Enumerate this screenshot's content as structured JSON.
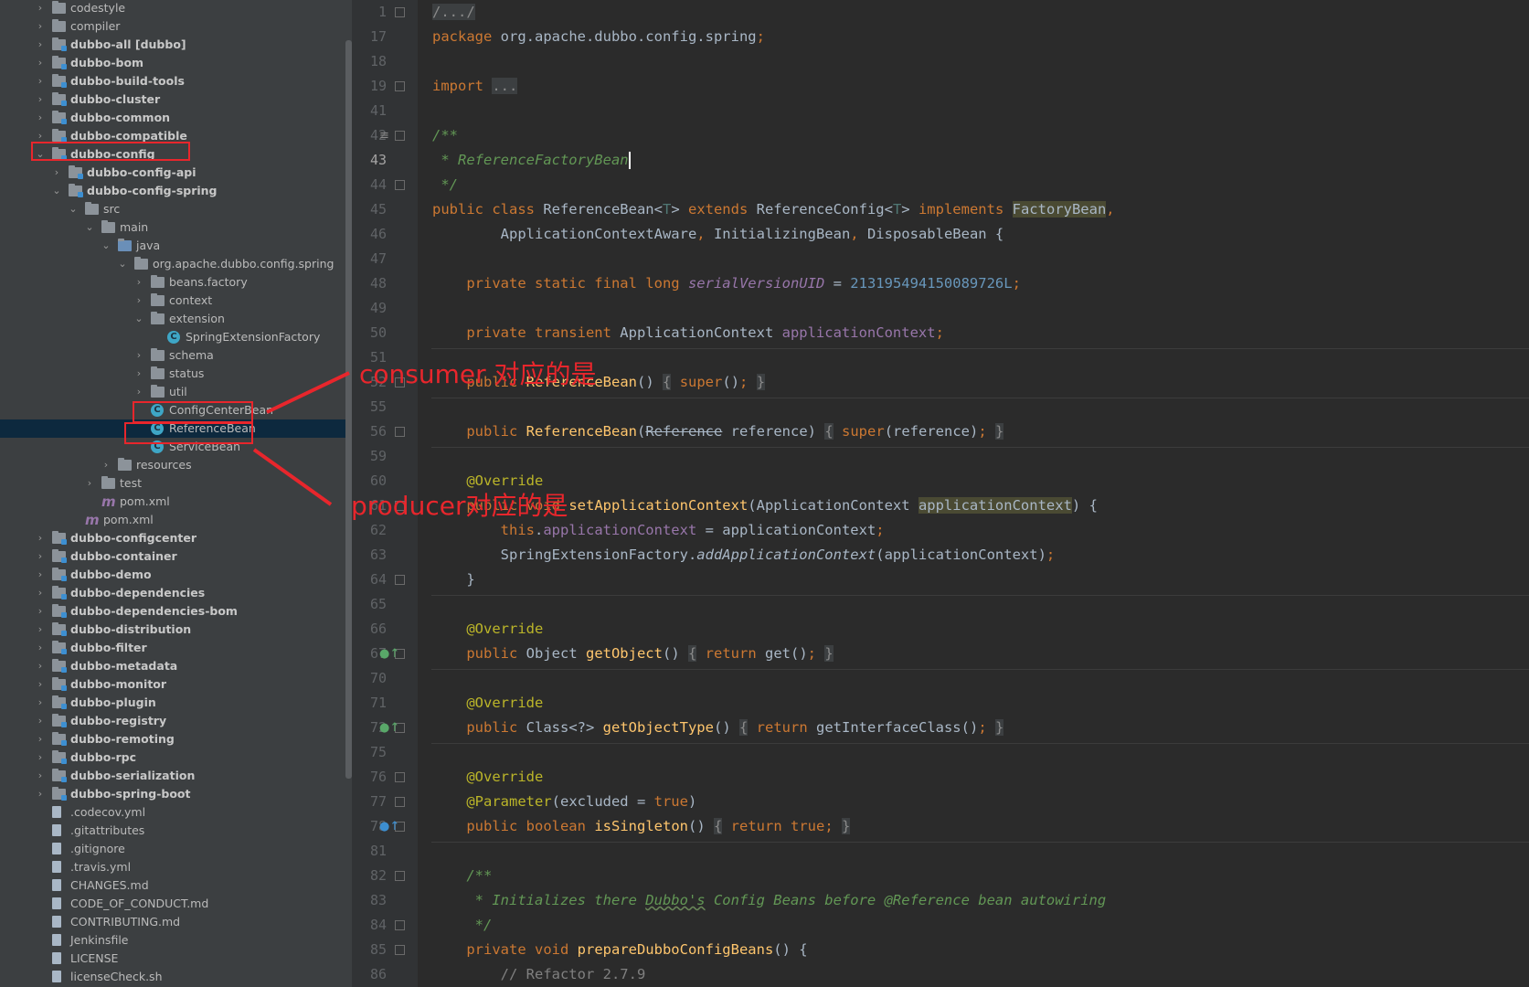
{
  "tree": {
    "items": [
      {
        "label": "codestyle",
        "indent": 0,
        "arrow": "›",
        "icon": "folder-icon",
        "bold": false
      },
      {
        "label": "compiler",
        "indent": 0,
        "arrow": "›",
        "icon": "folder-icon",
        "bold": false
      },
      {
        "label": "dubbo-all [dubbo]",
        "indent": 0,
        "arrow": "›",
        "icon": "module-icon",
        "bold": true
      },
      {
        "label": "dubbo-bom",
        "indent": 0,
        "arrow": "›",
        "icon": "module-icon",
        "bold": true
      },
      {
        "label": "dubbo-build-tools",
        "indent": 0,
        "arrow": "›",
        "icon": "module-icon",
        "bold": true
      },
      {
        "label": "dubbo-cluster",
        "indent": 0,
        "arrow": "›",
        "icon": "module-icon",
        "bold": true
      },
      {
        "label": "dubbo-common",
        "indent": 0,
        "arrow": "›",
        "icon": "module-icon",
        "bold": true
      },
      {
        "label": "dubbo-compatible",
        "indent": 0,
        "arrow": "›",
        "icon": "module-icon",
        "bold": true
      },
      {
        "label": "dubbo-config",
        "indent": 0,
        "arrow": "⌄",
        "icon": "module-icon",
        "bold": true
      },
      {
        "label": "dubbo-config-api",
        "indent": 1,
        "arrow": "›",
        "icon": "module-icon",
        "bold": true
      },
      {
        "label": "dubbo-config-spring",
        "indent": 1,
        "arrow": "⌄",
        "icon": "module-icon",
        "bold": true
      },
      {
        "label": "src",
        "indent": 2,
        "arrow": "⌄",
        "icon": "folder-icon",
        "bold": false
      },
      {
        "label": "main",
        "indent": 3,
        "arrow": "⌄",
        "icon": "folder-icon",
        "bold": false
      },
      {
        "label": "java",
        "indent": 4,
        "arrow": "⌄",
        "icon": "source-folder-icon",
        "bold": false
      },
      {
        "label": "org.apache.dubbo.config.spring",
        "indent": 5,
        "arrow": "⌄",
        "icon": "package-icon",
        "bold": false
      },
      {
        "label": "beans.factory",
        "indent": 6,
        "arrow": "›",
        "icon": "package-icon",
        "bold": false
      },
      {
        "label": "context",
        "indent": 6,
        "arrow": "›",
        "icon": "package-icon",
        "bold": false
      },
      {
        "label": "extension",
        "indent": 6,
        "arrow": "⌄",
        "icon": "package-icon",
        "bold": false
      },
      {
        "label": "SpringExtensionFactory",
        "indent": 7,
        "arrow": "",
        "icon": "class-icon",
        "bold": false
      },
      {
        "label": "schema",
        "indent": 6,
        "arrow": "›",
        "icon": "package-icon",
        "bold": false
      },
      {
        "label": "status",
        "indent": 6,
        "arrow": "›",
        "icon": "package-icon",
        "bold": false
      },
      {
        "label": "util",
        "indent": 6,
        "arrow": "›",
        "icon": "package-icon",
        "bold": false
      },
      {
        "label": "ConfigCenterBean",
        "indent": 6,
        "arrow": "",
        "icon": "class-icon",
        "bold": false
      },
      {
        "label": "ReferenceBean",
        "indent": 6,
        "arrow": "",
        "icon": "class-icon",
        "bold": false,
        "selected": true
      },
      {
        "label": "ServiceBean",
        "indent": 6,
        "arrow": "",
        "icon": "class-icon",
        "bold": false
      },
      {
        "label": "resources",
        "indent": 4,
        "arrow": "›",
        "icon": "resources-folder-icon",
        "bold": false
      },
      {
        "label": "test",
        "indent": 3,
        "arrow": "›",
        "icon": "folder-icon",
        "bold": false
      },
      {
        "label": "pom.xml",
        "indent": 3,
        "arrow": "",
        "icon": "maven-icon",
        "bold": false
      },
      {
        "label": "pom.xml",
        "indent": 2,
        "arrow": "",
        "icon": "maven-icon",
        "bold": false
      },
      {
        "label": "dubbo-configcenter",
        "indent": 0,
        "arrow": "›",
        "icon": "module-icon",
        "bold": true
      },
      {
        "label": "dubbo-container",
        "indent": 0,
        "arrow": "›",
        "icon": "module-icon",
        "bold": true
      },
      {
        "label": "dubbo-demo",
        "indent": 0,
        "arrow": "›",
        "icon": "module-icon",
        "bold": true
      },
      {
        "label": "dubbo-dependencies",
        "indent": 0,
        "arrow": "›",
        "icon": "module-icon",
        "bold": true
      },
      {
        "label": "dubbo-dependencies-bom",
        "indent": 0,
        "arrow": "›",
        "icon": "module-icon",
        "bold": true
      },
      {
        "label": "dubbo-distribution",
        "indent": 0,
        "arrow": "›",
        "icon": "module-icon",
        "bold": true
      },
      {
        "label": "dubbo-filter",
        "indent": 0,
        "arrow": "›",
        "icon": "module-icon",
        "bold": true
      },
      {
        "label": "dubbo-metadata",
        "indent": 0,
        "arrow": "›",
        "icon": "module-icon",
        "bold": true
      },
      {
        "label": "dubbo-monitor",
        "indent": 0,
        "arrow": "›",
        "icon": "module-icon",
        "bold": true
      },
      {
        "label": "dubbo-plugin",
        "indent": 0,
        "arrow": "›",
        "icon": "module-icon",
        "bold": true
      },
      {
        "label": "dubbo-registry",
        "indent": 0,
        "arrow": "›",
        "icon": "module-icon",
        "bold": true
      },
      {
        "label": "dubbo-remoting",
        "indent": 0,
        "arrow": "›",
        "icon": "module-icon",
        "bold": true
      },
      {
        "label": "dubbo-rpc",
        "indent": 0,
        "arrow": "›",
        "icon": "module-icon",
        "bold": true
      },
      {
        "label": "dubbo-serialization",
        "indent": 0,
        "arrow": "›",
        "icon": "module-icon",
        "bold": true
      },
      {
        "label": "dubbo-spring-boot",
        "indent": 0,
        "arrow": "›",
        "icon": "module-icon",
        "bold": true
      },
      {
        "label": ".codecov.yml",
        "indent": 0,
        "arrow": "",
        "icon": "yaml-file-icon",
        "bold": false
      },
      {
        "label": ".gitattributes",
        "indent": 0,
        "arrow": "",
        "icon": "text-file-icon",
        "bold": false
      },
      {
        "label": ".gitignore",
        "indent": 0,
        "arrow": "",
        "icon": "gitignore-file-icon",
        "bold": false
      },
      {
        "label": ".travis.yml",
        "indent": 0,
        "arrow": "",
        "icon": "yaml-file-icon",
        "bold": false
      },
      {
        "label": "CHANGES.md",
        "indent": 0,
        "arrow": "",
        "icon": "markdown-file-icon",
        "bold": false
      },
      {
        "label": "CODE_OF_CONDUCT.md",
        "indent": 0,
        "arrow": "",
        "icon": "markdown-file-icon",
        "bold": false
      },
      {
        "label": "CONTRIBUTING.md",
        "indent": 0,
        "arrow": "",
        "icon": "markdown-file-icon",
        "bold": false
      },
      {
        "label": "Jenkinsfile",
        "indent": 0,
        "arrow": "",
        "icon": "text-file-icon",
        "bold": false
      },
      {
        "label": "LICENSE",
        "indent": 0,
        "arrow": "",
        "icon": "text-file-icon",
        "bold": false
      },
      {
        "label": "licenseCheck.sh",
        "indent": 0,
        "arrow": "",
        "icon": "shell-file-icon",
        "bold": false
      }
    ]
  },
  "editor": {
    "current_line": "43",
    "lines": [
      {
        "num": "1",
        "html": "<span class=\"fb\">/.../</span>"
      },
      {
        "num": "17",
        "html": "<span class=\"k\">package</span> org.apache.dubbo.config.spring<span class=\"k\">;</span>"
      },
      {
        "num": "18",
        "html": ""
      },
      {
        "num": "19",
        "html": "<span class=\"k\">import</span> <span class=\"fb\">...</span>"
      },
      {
        "num": "41",
        "html": ""
      },
      {
        "num": "42",
        "html": "<span class=\"cm\">/**</span>"
      },
      {
        "num": "43",
        "html": "<span class=\"cm\"> * ReferenceFactoryBean</span><span class=\"caret\"></span>"
      },
      {
        "num": "44",
        "html": "<span class=\"cm\"> */</span>"
      },
      {
        "num": "45",
        "html": "<span class=\"k\">public class</span> ReferenceBean&lt;<span class=\"tp\">T</span>&gt; <span class=\"k\">extends</span> ReferenceConfig&lt;<span class=\"tp\">T</span>&gt; <span class=\"k\">implements</span> <span class=\"hl2\">FactoryBean</span><span class=\"k\">,</span>"
      },
      {
        "num": "46",
        "html": "        ApplicationContextAware<span class=\"k\">,</span> InitializingBean<span class=\"k\">,</span> DisposableBean {"
      },
      {
        "num": "47",
        "html": ""
      },
      {
        "num": "48",
        "html": "    <span class=\"k\">private static final long</span> <span class=\"fii\">serialVersionUID</span> = <span class=\"n\">213195494150089726L</span><span class=\"k\">;</span>"
      },
      {
        "num": "49",
        "html": ""
      },
      {
        "num": "50",
        "html": "    <span class=\"k\">private transient</span> ApplicationContext <span class=\"fi\">applicationContext</span><span class=\"k\">;</span>"
      },
      {
        "num": "51",
        "html": ""
      },
      {
        "num": "52",
        "html": "    <span class=\"k\">public</span> <span class=\"f\">ReferenceBean</span>() <span class=\"fb\">{</span> <span class=\"k\">super</span>()<span class=\"k\">;</span> <span class=\"fb\">}</span>"
      },
      {
        "num": "55",
        "html": ""
      },
      {
        "num": "56",
        "html": "    <span class=\"k\">public</span> <span class=\"f\">ReferenceBean</span>(<span class=\"strike\">Reference</span> reference) <span class=\"fb\">{</span> <span class=\"k\">super</span>(reference)<span class=\"k\">;</span> <span class=\"fb\">}</span>"
      },
      {
        "num": "59",
        "html": ""
      },
      {
        "num": "60",
        "html": "    <span class=\"an\">@Override</span>"
      },
      {
        "num": "61",
        "html": "    <span class=\"k\">public void</span> <span class=\"f\">setApplicationContext</span>(ApplicationContext <span class=\"hl2\">applicationContext</span>) {"
      },
      {
        "num": "62",
        "html": "        <span class=\"k\">this</span>.<span class=\"fi\">applicationContext</span> = applicationContext<span class=\"k\">;</span>"
      },
      {
        "num": "63",
        "html": "        SpringExtensionFactory.<span class=\"mi\">addApplicationContext</span>(applicationContext)<span class=\"k\">;</span>"
      },
      {
        "num": "64",
        "html": "    }"
      },
      {
        "num": "65",
        "html": ""
      },
      {
        "num": "66",
        "html": "    <span class=\"an\">@Override</span>"
      },
      {
        "num": "67",
        "html": "    <span class=\"k\">public</span> Object <span class=\"f\">getObject</span>() <span class=\"fb\">{</span> <span class=\"k\">return</span> get()<span class=\"k\">;</span> <span class=\"fb\">}</span>"
      },
      {
        "num": "70",
        "html": ""
      },
      {
        "num": "71",
        "html": "    <span class=\"an\">@Override</span>"
      },
      {
        "num": "72",
        "html": "    <span class=\"k\">public</span> Class&lt;?&gt; <span class=\"f\">getObjectType</span>() <span class=\"fb\">{</span> <span class=\"k\">return</span> getInterfaceClass()<span class=\"k\">;</span> <span class=\"fb\">}</span>"
      },
      {
        "num": "75",
        "html": ""
      },
      {
        "num": "76",
        "html": "    <span class=\"an\">@Override</span>"
      },
      {
        "num": "77",
        "html": "    <span class=\"an\">@Parameter</span>(excluded = <span class=\"k\">true</span>)"
      },
      {
        "num": "78",
        "html": "    <span class=\"k\">public boolean</span> <span class=\"f\">isSingleton</span>() <span class=\"fb\">{</span> <span class=\"k\">return true;</span> <span class=\"fb\">}</span>"
      },
      {
        "num": "81",
        "html": ""
      },
      {
        "num": "82",
        "html": "    <span class=\"cm\">/**</span>"
      },
      {
        "num": "83",
        "html": "<span class=\"cm\">     * Initializes there <span class=\"wavy\">Dubbo's</span> Config Beans before @Reference bean autowiring</span>"
      },
      {
        "num": "84",
        "html": "<span class=\"cm\">     */</span>"
      },
      {
        "num": "85",
        "html": "    <span class=\"k\">private void</span> <span class=\"f\">prepareDubboConfigBeans</span>() {"
      },
      {
        "num": "86",
        "html": "        <span class=\"cg\">// Refactor 2.7.9</span>"
      }
    ]
  },
  "annotations": {
    "consumer_text": "consumer 对应的是",
    "producer_text": "producer对应的是"
  },
  "colors": {
    "annotation_red": "#e8262c",
    "selection_bg": "#0d293e",
    "keyword": "#cc7832",
    "method": "#ffc66d"
  }
}
